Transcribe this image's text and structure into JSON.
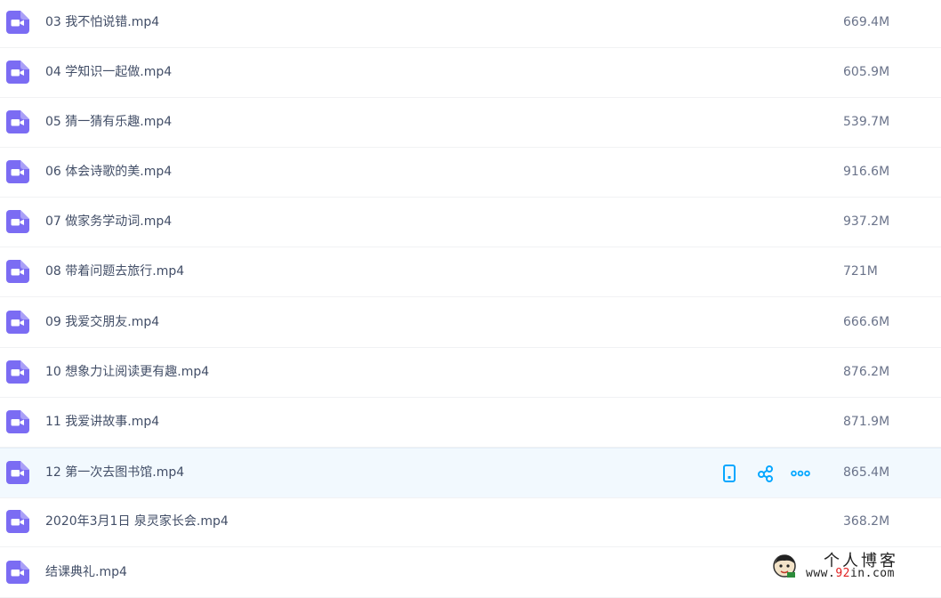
{
  "colors": {
    "video_icon": "#7b6cf3",
    "action_icon": "#06a7ff",
    "hover_row": "#f2f9fe"
  },
  "files": [
    {
      "name": "03 我不怕说错.mp4",
      "size": "669.4M",
      "icon": "video-file-icon"
    },
    {
      "name": "04 学知识一起做.mp4",
      "size": "605.9M",
      "icon": "video-file-icon"
    },
    {
      "name": "05 猜一猜有乐趣.mp4",
      "size": "539.7M",
      "icon": "video-file-icon"
    },
    {
      "name": "06 体会诗歌的美.mp4",
      "size": "916.6M",
      "icon": "video-file-icon"
    },
    {
      "name": "07 做家务学动词.mp4",
      "size": "937.2M",
      "icon": "video-file-icon"
    },
    {
      "name": "08 带着问题去旅行.mp4",
      "size": "721M",
      "icon": "video-file-icon"
    },
    {
      "name": "09 我爱交朋友.mp4",
      "size": "666.6M",
      "icon": "video-file-icon"
    },
    {
      "name": "10 想象力让阅读更有趣.mp4",
      "size": "876.2M",
      "icon": "video-file-icon"
    },
    {
      "name": "11 我爱讲故事.mp4",
      "size": "871.9M",
      "icon": "video-file-icon"
    },
    {
      "name": "12 第一次去图书馆.mp4",
      "size": "865.4M",
      "icon": "video-file-icon",
      "hovered": true,
      "actions": [
        "phone-icon",
        "share-icon",
        "more-icon"
      ]
    },
    {
      "name": "2020年3月1日 泉灵家长会.mp4",
      "size": "368.2M",
      "icon": "video-file-icon"
    },
    {
      "name": "结课典礼.mp4",
      "size": "",
      "icon": "video-file-icon"
    }
  ],
  "watermark": {
    "title": "个人博客",
    "url_prefix": "www.",
    "url_number": "92",
    "url_suffix": "in.com"
  }
}
